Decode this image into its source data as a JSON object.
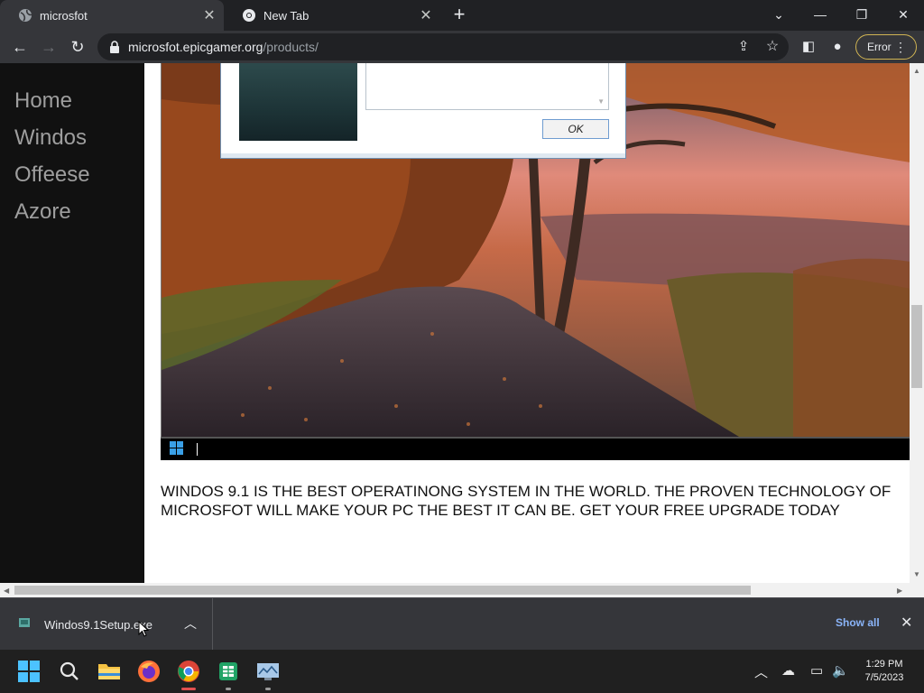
{
  "browser": {
    "tabs": [
      {
        "title": "microsfot",
        "active": true
      },
      {
        "title": "New Tab",
        "active": false
      }
    ],
    "url_host": "microsfot.epicgamer.org",
    "url_path": "/products/",
    "profile_chip": "Error"
  },
  "page": {
    "nav": [
      "Home",
      "Windos",
      "Offeese",
      "Azore"
    ],
    "dialog": {
      "ok_label": "OK"
    },
    "body_text": "WINDOS 9.1 IS THE BEST OPERATINONG SYSTEM IN THE WORLD. THE PROVEN TECHNOLOGY OF MICROSFOT WILL MAKE YOUR PC THE BEST IT CAN BE. GET YOUR FREE UPGRADE TODAY"
  },
  "downloads": {
    "file_name": "Windos9.1Setup.exe",
    "show_all_label": "Show all"
  },
  "taskbar": {
    "apps": [
      "start-icon",
      "search-icon",
      "file-explorer-icon",
      "firefox-icon",
      "chrome-icon",
      "spreadsheet-icon",
      "monitor-app-icon"
    ],
    "time": "1:29 PM",
    "date": "7/5/2023"
  },
  "colors": {
    "error_chip_border": "#d0b453",
    "show_all": "#8ab4f8",
    "active_indicator": "#e05050"
  }
}
